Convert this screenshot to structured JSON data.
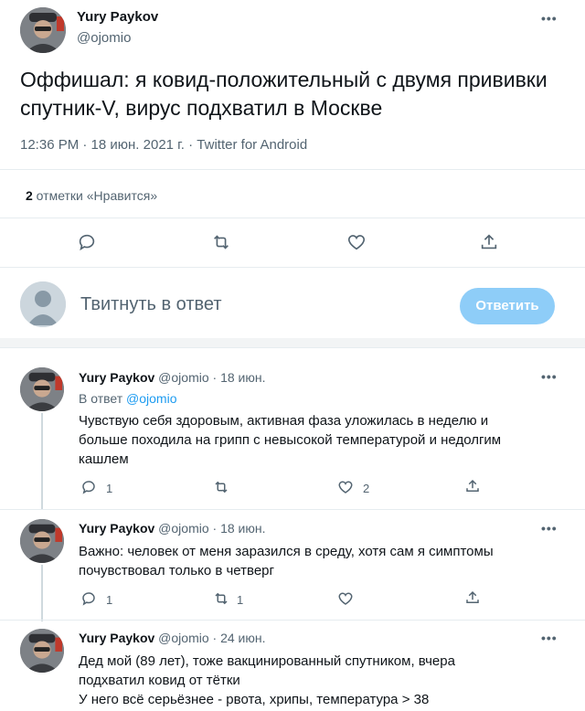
{
  "main_tweet": {
    "author_name": "Yury Paykov",
    "author_handle": "@ojomio",
    "more_label": "•••",
    "text_line1": "Оффишал: я ковид-положительный с двумя прививки",
    "text_line2": "спутник-V, вирус подхватил в Москве",
    "timestamp": "12:36 PM · 18 июн. 2021 г. · Twitter for Android",
    "likes_count": "2",
    "likes_label": " отметки «Нравится»"
  },
  "compose": {
    "placeholder": "Твитнуть в ответ",
    "reply_button": "Ответить"
  },
  "replies": [
    {
      "author_name": "Yury Paykov",
      "author_meta": "@ojomio · 18 июн.",
      "reply_to_prefix": "В ответ ",
      "reply_to_handle": "@ojomio",
      "line1": "Чувствую себя здоровым, активная фаза уложилась в неделю и",
      "line2": "больше походила на грипп с невысокой температурой и недолгим",
      "line3": "кашлем",
      "reply_count": "1",
      "retweet_count": "",
      "like_count": "2"
    },
    {
      "author_name": "Yury Paykov",
      "author_meta": "@ojomio · 18 июн.",
      "line1": "Важно: человек от меня заразился в среду, хотя сам я симптомы",
      "line2": "почувствовал только в четверг",
      "reply_count": "1",
      "retweet_count": "1",
      "like_count": ""
    },
    {
      "author_name": "Yury Paykov",
      "author_meta": "@ojomio · 24 июн.",
      "line1": "Дед мой (89 лет), тоже вакцинированный спутником, вчера",
      "line2": "подхватил ковид от тётки",
      "line3": "У него всё серьёзнее - рвота, хрипы, температура > 38"
    }
  ],
  "colors": {
    "accent": "#1d9bf0",
    "reply_button_bg": "#8ecdf8",
    "secondary_text": "#536471"
  }
}
